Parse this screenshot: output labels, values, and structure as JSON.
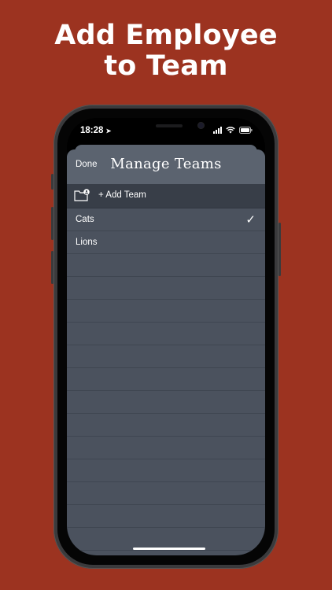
{
  "headline": [
    "Add Employee",
    "to Team"
  ],
  "status": {
    "time": "18:28"
  },
  "navbar": {
    "done_label": "Done",
    "title": "Manage Teams"
  },
  "add_team": {
    "label": "+ Add Team"
  },
  "teams": [
    {
      "name": "Cats",
      "selected": true
    },
    {
      "name": "Lions",
      "selected": false
    }
  ],
  "empty_rows": 13,
  "colors": {
    "background": "#9c3320",
    "sheet": "#4b525e",
    "navbar": "#5b636f",
    "add_row": "#383e48"
  }
}
